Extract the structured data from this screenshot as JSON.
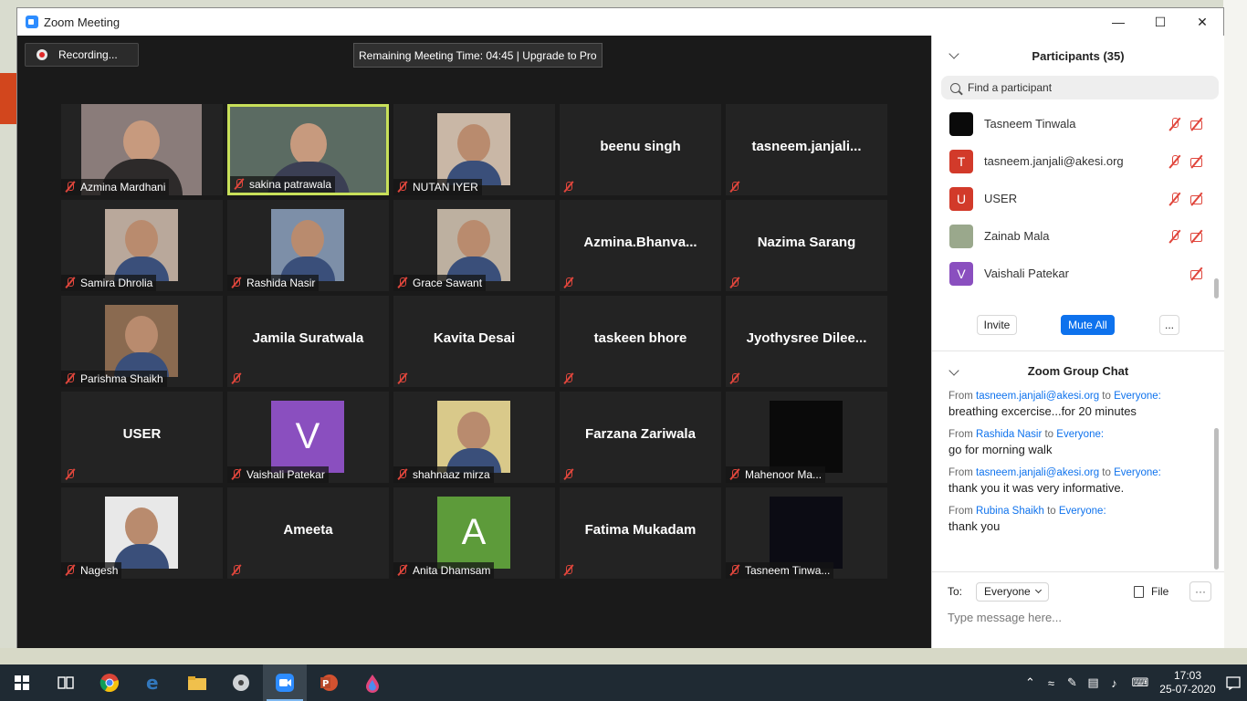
{
  "window": {
    "title": "Zoom Meeting"
  },
  "recording": {
    "label": "Recording..."
  },
  "timer": {
    "text": "Remaining Meeting Time: 04:45 | Upgrade to Pro"
  },
  "tiles": [
    {
      "label": "Azmina Mardhani",
      "type": "video",
      "bg": "#8a7c7a"
    },
    {
      "label": "sakina patrawala",
      "type": "video",
      "bg": "#5b6b62",
      "active": true
    },
    {
      "label": "NUTAN IYER",
      "type": "photo",
      "bg": "#c9b7a6"
    },
    {
      "big": "beenu singh"
    },
    {
      "big": "tasneem.janjali..."
    },
    {
      "label": "Samira Dhrolia",
      "type": "photo",
      "bg": "#b9a89b"
    },
    {
      "label": "Rashida Nasir",
      "type": "photo",
      "bg": "#7d8fa8"
    },
    {
      "label": "Grace Sawant",
      "type": "photo",
      "bg": "#bdb0a0"
    },
    {
      "big": "Azmina.Bhanva..."
    },
    {
      "big": "Nazima Sarang"
    },
    {
      "label": "Parishma Shaikh",
      "type": "photo",
      "bg": "#8a6a50"
    },
    {
      "big": "Jamila Suratwala"
    },
    {
      "big": "Kavita Desai"
    },
    {
      "big": "taskeen bhore"
    },
    {
      "big": "Jyothysree  Dilee..."
    },
    {
      "big": "USER"
    },
    {
      "label": "Vaishali Patekar",
      "type": "letter",
      "letter": "V",
      "bg": "#8a4fbf"
    },
    {
      "label": "shahnaaz mirza",
      "type": "photo",
      "bg": "#d9c98a"
    },
    {
      "big": "Farzana Zariwala"
    },
    {
      "label": "Mahenoor Ma...",
      "type": "photo",
      "bg": "#0a0a0a"
    },
    {
      "label": "Nagesh  ",
      "type": "photo",
      "bg": "#e8e8e8"
    },
    {
      "big": "Ameeta"
    },
    {
      "label": "Anita Dhamsam",
      "type": "letter",
      "letter": "A",
      "bg": "#5d9b3a"
    },
    {
      "big": "Fatima Mukadam"
    },
    {
      "label": "Tasneem Tinwa...",
      "type": "photo",
      "bg": "#0c0c14"
    }
  ],
  "participants": {
    "title": "Participants (35)",
    "search_placeholder": "Find a participant",
    "list": [
      {
        "name": "Tasneem Tinwala",
        "initial": "",
        "color": "#0a0a0a",
        "mic_off": true
      },
      {
        "name": "tasneem.janjali@akesi.org",
        "initial": "T",
        "color": "#d23a2a",
        "mic_off": true
      },
      {
        "name": "USER",
        "initial": "U",
        "color": "#d23a2a",
        "mic_off": true
      },
      {
        "name": "Zainab Mala",
        "initial": "",
        "color": "#9aa88c",
        "mic_off": true
      },
      {
        "name": "Vaishali Patekar",
        "initial": "V",
        "color": "#8a4fbf",
        "mic_off": false
      }
    ],
    "invite_label": "Invite",
    "mute_all_label": "Mute All",
    "more_label": "..."
  },
  "chat": {
    "title": "Zoom Group Chat",
    "messages": [
      {
        "from": "tasneem.janjali@akesi.org",
        "to": "Everyone:",
        "text": "breathing excercise...for 20 minutes"
      },
      {
        "from": "Rashida Nasir",
        "to": "Everyone:",
        "text": "go for morning walk"
      },
      {
        "from": "tasneem.janjali@akesi.org",
        "to": "Everyone:",
        "text": "thank you it was very informative."
      },
      {
        "from": "Rubina Shaikh",
        "to": "Everyone:",
        "text": "thank you"
      }
    ],
    "from_word": "From",
    "to_word": "to",
    "to_label": "To:",
    "to_value": "Everyone",
    "file_label": "File",
    "placeholder": "Type message here..."
  },
  "taskbar": {
    "time": "17:03",
    "date": "25-07-2020"
  }
}
